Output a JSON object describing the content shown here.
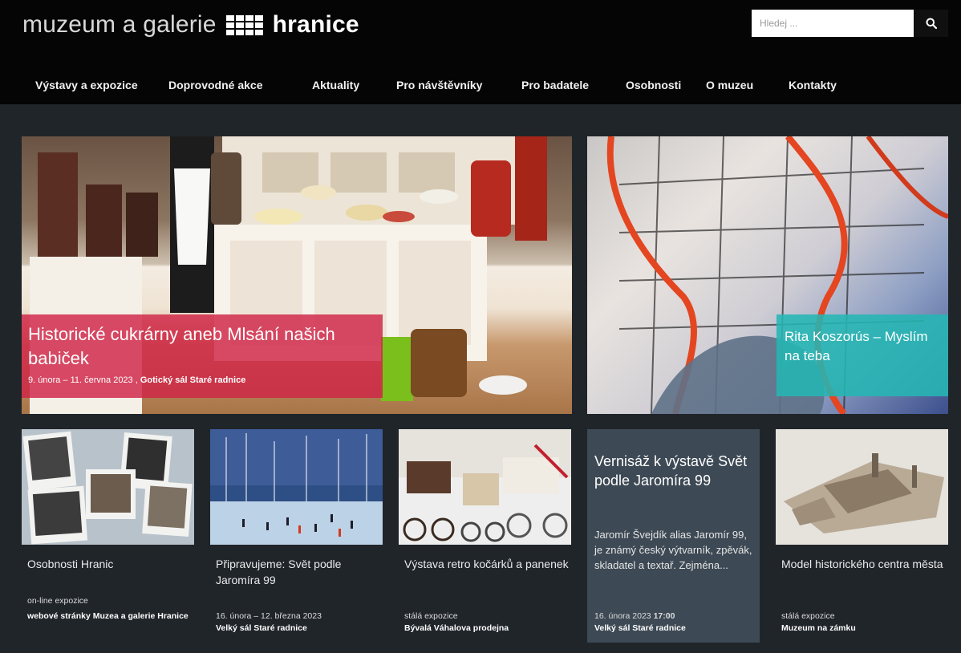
{
  "header": {
    "logo_text_light": "muzeum a galerie",
    "logo_text_bold": "hranice",
    "search_placeholder": "Hledej ...",
    "search_icon": "search-icon"
  },
  "nav": {
    "items": [
      {
        "label": "Výstavy a expozice"
      },
      {
        "label": "Doprovodné akce"
      },
      {
        "label": "Aktuality"
      },
      {
        "label": "Pro návštěvníky"
      },
      {
        "label": "Pro badatele"
      },
      {
        "label": "Osobnosti"
      },
      {
        "label": "O muzeu"
      },
      {
        "label": "Kontakty"
      }
    ]
  },
  "hero": {
    "left": {
      "title": "Historické cukrárny aneb Mlsání našich babiček",
      "dates": "9. února – 11. června 2023",
      "place": "Gotický sál Staré radnice"
    },
    "right": {
      "title": "Rita Koszorús – Myslím na teba"
    }
  },
  "cards": [
    {
      "title": "Osobnosti Hranic",
      "type": "on-line expozice",
      "place": "webové stránky Muzea a galerie Hranice"
    },
    {
      "title": "Připravujeme: Svět podle Jaromíra 99",
      "dates": "16. února – 12. března 2023",
      "place": "Velký sál Staré radnice"
    },
    {
      "title": "Výstava retro kočárků a panenek",
      "type": "stálá expozice",
      "place": "Bývalá Váhalova prodejna"
    },
    {
      "title": "Vernisáž k výstavě Svět podle Jaromíra 99",
      "text": "Jaromír Švejdík alias Jaromír 99, je známý český výtvarník, zpěvák, skladatel a textař. Zejména...",
      "date": "16. února 2023",
      "time": "17:00",
      "place": "Velký sál Staré radnice"
    },
    {
      "title": "Model historického centra města",
      "type": "stálá expozice",
      "place": "Muzeum na zámku"
    }
  ],
  "colors": {
    "page_bg": "#20252a",
    "header_bg": "#050505",
    "hero_left_label": "#d02346",
    "hero_right_label": "#24b6b4",
    "card_highlight": "#3d4954"
  }
}
